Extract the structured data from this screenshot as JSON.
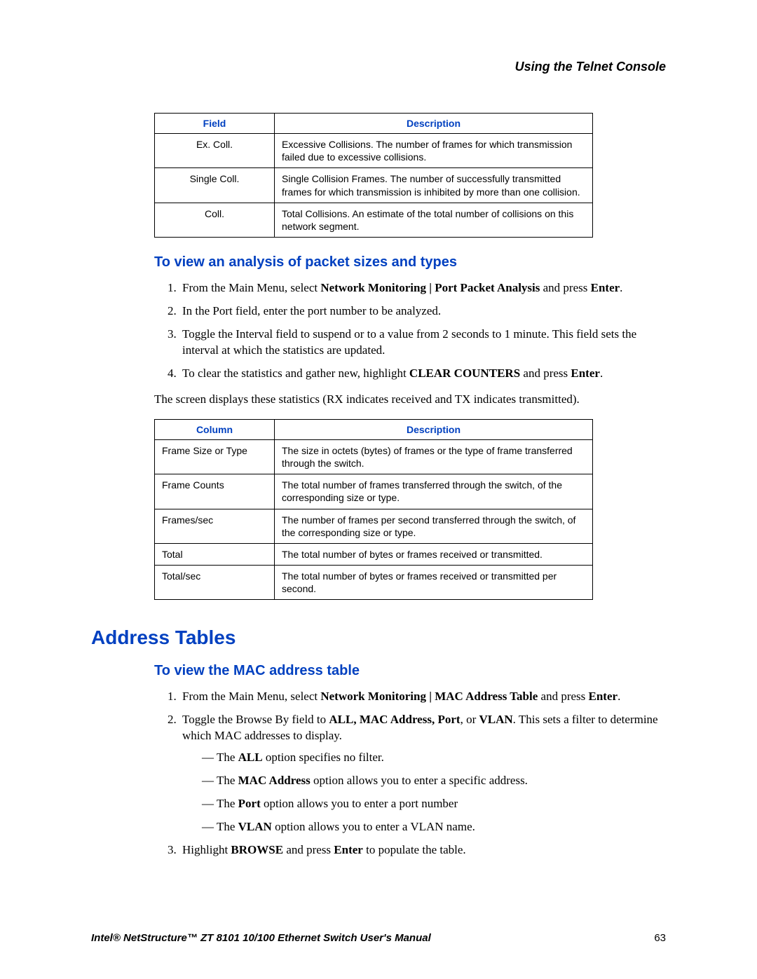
{
  "header": {
    "title": "Using the Telnet Console"
  },
  "table1": {
    "col1": "Field",
    "col2": "Description",
    "rows": [
      {
        "field": "Ex. Coll.",
        "desc": "Excessive Collisions. The number of frames for which transmission failed due to excessive collisions."
      },
      {
        "field": "Single Coll.",
        "desc": "Single Collision Frames. The number of successfully transmitted frames for which transmission is inhibited by more than one collision."
      },
      {
        "field": "Coll.",
        "desc": "Total Collisions. An estimate of the total number of collisions on this network segment."
      }
    ]
  },
  "section1": {
    "heading": "To view an analysis of packet sizes and types",
    "step1_a": "From the Main Menu, select ",
    "step1_b": "Network Monitoring | Port Packet Analysis",
    "step1_c": " and press ",
    "step1_d": "Enter",
    "step1_e": ".",
    "step2": "In the Port field, enter the port number to be analyzed.",
    "step3": "Toggle the Interval field to suspend or to a value from 2 seconds to 1 minute. This field sets the interval at which the statistics are updated.",
    "step4_a": "To clear the statistics and gather new, highlight ",
    "step4_b": "CLEAR COUNTERS",
    "step4_c": " and press ",
    "step4_d": "Enter",
    "step4_e": ".",
    "paragraph": "The screen displays these statistics (RX indicates received and TX indicates transmitted)."
  },
  "table2": {
    "col1": "Column",
    "col2": "Description",
    "rows": [
      {
        "field": "Frame Size or Type",
        "desc": "The size in octets (bytes) of frames or the type of frame transferred through the switch."
      },
      {
        "field": "Frame Counts",
        "desc": "The total number of frames transferred through the switch, of the corresponding size or type."
      },
      {
        "field": "Frames/sec",
        "desc": "The number of frames per second transferred through the switch, of the corresponding size or type."
      },
      {
        "field": "Total",
        "desc": "The total number of bytes or frames received or transmitted."
      },
      {
        "field": "Total/sec",
        "desc": "The total number of bytes or frames received or transmitted per second."
      }
    ]
  },
  "section2": {
    "heading_main": "Address Tables",
    "heading_sub": "To view the MAC address table",
    "step1_a": "From the Main Menu, select ",
    "step1_b": "Network Monitoring | MAC Address Table",
    "step1_c": " and press ",
    "step1_d": "Enter",
    "step1_e": ".",
    "step2_a": "Toggle the Browse By field to ",
    "step2_b": "ALL, MAC Address, Port",
    "step2_c": ", or ",
    "step2_d": "VLAN",
    "step2_e": ". This sets a filter to determine which MAC addresses to display.",
    "d1_a": "The ",
    "d1_b": "ALL",
    "d1_c": " option specifies no filter.",
    "d2_a": "The ",
    "d2_b": "MAC Address",
    "d2_c": " option allows you to enter a specific address.",
    "d3_a": "The ",
    "d3_b": "Port",
    "d3_c": " option allows you to enter a port number",
    "d4_a": "The ",
    "d4_b": "VLAN",
    "d4_c": " option allows you to enter a VLAN name.",
    "step3_a": "Highlight ",
    "step3_b": "BROWSE",
    "step3_c": " and press ",
    "step3_d": "Enter",
    "step3_e": " to populate the table."
  },
  "footer": {
    "text": "Intel® NetStructure™  ZT 8101 10/100 Ethernet Switch User's Manual",
    "page": "63"
  }
}
